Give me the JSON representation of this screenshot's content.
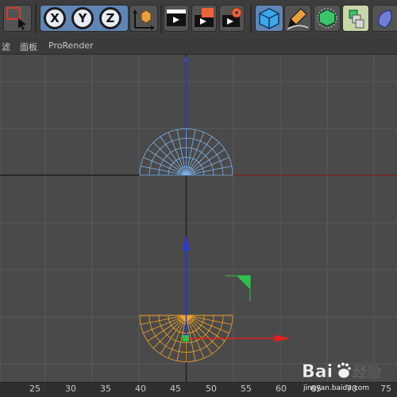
{
  "toolbar": {
    "axis_x": "X",
    "axis_y": "Y",
    "axis_z": "Z"
  },
  "menu": {
    "items": [
      "滤",
      "面板",
      "ProRender"
    ]
  },
  "ruler": {
    "ticks": [
      "25",
      "30",
      "35",
      "40",
      "45",
      "50",
      "55",
      "60",
      "65",
      "70",
      "75"
    ]
  },
  "watermark": {
    "brand": "Bai",
    "brand2": "du",
    "cn": "经验",
    "url": "jingyan.baidu.com"
  },
  "colors": {
    "viewport_bg": "#4a4a4a",
    "grid": "#5a5a5a",
    "wire_blue": "#7fb2e8",
    "wire_orange": "#f5a623",
    "axis_blue": "#2b3bd6",
    "axis_red": "#e02020",
    "axis_green": "#2fc24a"
  }
}
